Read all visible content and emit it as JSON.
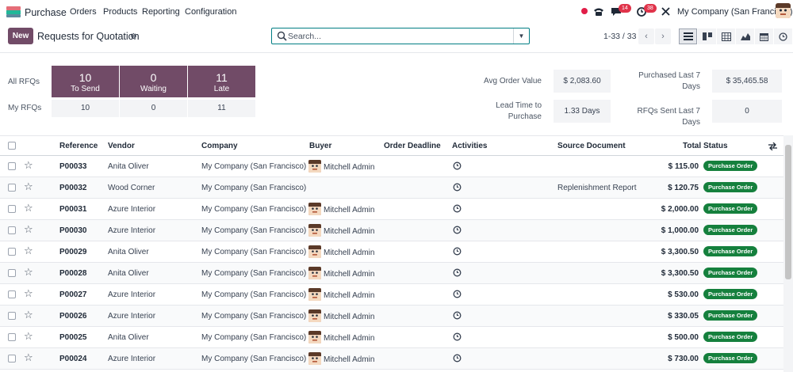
{
  "nav": {
    "app_name": "Purchase",
    "menu": [
      "Orders",
      "Products",
      "Reporting",
      "Configuration"
    ],
    "badges": {
      "messages": "14",
      "activities": "38"
    },
    "company": "My Company (San Francisco)"
  },
  "control": {
    "new_label": "New",
    "title": "Requests for Quotation",
    "search_placeholder": "Search...",
    "pager": "1-33 / 33"
  },
  "dashboard": {
    "all_rfqs_label": "All RFQs",
    "my_rfqs_label": "My RFQs",
    "tiles": [
      {
        "num": "10",
        "label": "To Send",
        "my": "10"
      },
      {
        "num": "0",
        "label": "Waiting",
        "my": "0"
      },
      {
        "num": "11",
        "label": "Late",
        "my": "11"
      }
    ],
    "kpis": {
      "avg_order_value_label": "Avg Order Value",
      "avg_order_value": "$ 2,083.60",
      "purchased_last7_label": "Purchased Last 7 Days",
      "purchased_last7": "$ 35,465.58",
      "lead_time_label": "Lead Time to Purchase",
      "lead_time": "1.33 Days",
      "rfqs_sent_label": "RFQs Sent Last 7 Days",
      "rfqs_sent": "0"
    }
  },
  "table": {
    "headers": {
      "reference": "Reference",
      "vendor": "Vendor",
      "company": "Company",
      "buyer": "Buyer",
      "deadline": "Order Deadline",
      "activities": "Activities",
      "source": "Source Document",
      "total": "Total",
      "status": "Status"
    },
    "rows": [
      {
        "ref": "P00033",
        "vendor": "Anita Oliver",
        "company": "My Company (San Francisco)",
        "buyer": "Mitchell Admin",
        "source": "",
        "total": "$ 115.00",
        "status": "Purchase Order"
      },
      {
        "ref": "P00032",
        "vendor": "Wood Corner",
        "company": "My Company (San Francisco)",
        "buyer": "",
        "source": "Replenishment Report",
        "total": "$ 120.75",
        "status": "Purchase Order"
      },
      {
        "ref": "P00031",
        "vendor": "Azure Interior",
        "company": "My Company (San Francisco)",
        "buyer": "Mitchell Admin",
        "source": "",
        "total": "$ 2,000.00",
        "status": "Purchase Order"
      },
      {
        "ref": "P00030",
        "vendor": "Azure Interior",
        "company": "My Company (San Francisco)",
        "buyer": "Mitchell Admin",
        "source": "",
        "total": "$ 1,000.00",
        "status": "Purchase Order"
      },
      {
        "ref": "P00029",
        "vendor": "Anita Oliver",
        "company": "My Company (San Francisco)",
        "buyer": "Mitchell Admin",
        "source": "",
        "total": "$ 3,300.50",
        "status": "Purchase Order"
      },
      {
        "ref": "P00028",
        "vendor": "Anita Oliver",
        "company": "My Company (San Francisco)",
        "buyer": "Mitchell Admin",
        "source": "",
        "total": "$ 3,300.50",
        "status": "Purchase Order"
      },
      {
        "ref": "P00027",
        "vendor": "Azure Interior",
        "company": "My Company (San Francisco)",
        "buyer": "Mitchell Admin",
        "source": "",
        "total": "$ 530.00",
        "status": "Purchase Order"
      },
      {
        "ref": "P00026",
        "vendor": "Azure Interior",
        "company": "My Company (San Francisco)",
        "buyer": "Mitchell Admin",
        "source": "",
        "total": "$ 330.05",
        "status": "Purchase Order"
      },
      {
        "ref": "P00025",
        "vendor": "Anita Oliver",
        "company": "My Company (San Francisco)",
        "buyer": "Mitchell Admin",
        "source": "",
        "total": "$ 500.00",
        "status": "Purchase Order"
      },
      {
        "ref": "P00024",
        "vendor": "Azure Interior",
        "company": "My Company (San Francisco)",
        "buyer": "Mitchell Admin",
        "source": "",
        "total": "$ 730.00",
        "status": "Purchase Order"
      }
    ]
  },
  "colors": {
    "brand": "#714b67",
    "status_green": "#15803d",
    "search_border": "#017e84"
  }
}
